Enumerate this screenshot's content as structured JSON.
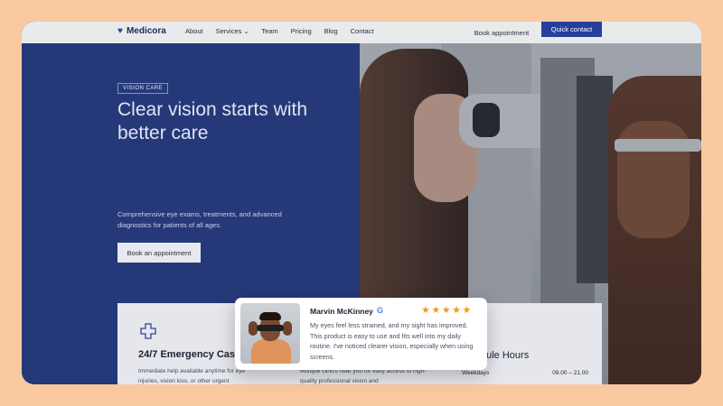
{
  "nav": {
    "logo": "Medicora",
    "links": [
      "About",
      "Services",
      "Team",
      "Pricing",
      "Blog",
      "Contact"
    ],
    "services_caret": "⌄",
    "book_label": "Book appointment",
    "quick_label": "Quick contact"
  },
  "hero": {
    "tag": "VISION CARE",
    "headline": "Clear vision starts with better care",
    "subtext": "Comprehensive eye exams, treatments, and advanced diagnostics for patients of all ages.",
    "cta": "Book an appointment"
  },
  "cards": {
    "emergency": {
      "icon": "medical-cross-icon",
      "title": "24/7 Emergency Cases",
      "desc": "Immediate help available anytime for eye injuries, vision loss, or other urgent"
    },
    "clinics": {
      "desc": "Multiple clinics near you for easy access to high-quality professional vision and"
    },
    "schedule": {
      "title": "dule Hours",
      "row_label": "Weekdays",
      "row_value": "09.00 – 21.00"
    }
  },
  "review": {
    "name": "Marvin McKinney",
    "source_icon": "google-icon",
    "source_glyph": "G",
    "stars": "★★★★★",
    "rating": 5,
    "text": "My eyes feel less strained, and my sight has improved. This product is easy to use and fits well into my daily routine. I've noticed clearer vision, especially when using screens."
  },
  "colors": {
    "brand": "#2a4498",
    "page_bg": "#fbc9a0",
    "star": "#f39a1b"
  }
}
